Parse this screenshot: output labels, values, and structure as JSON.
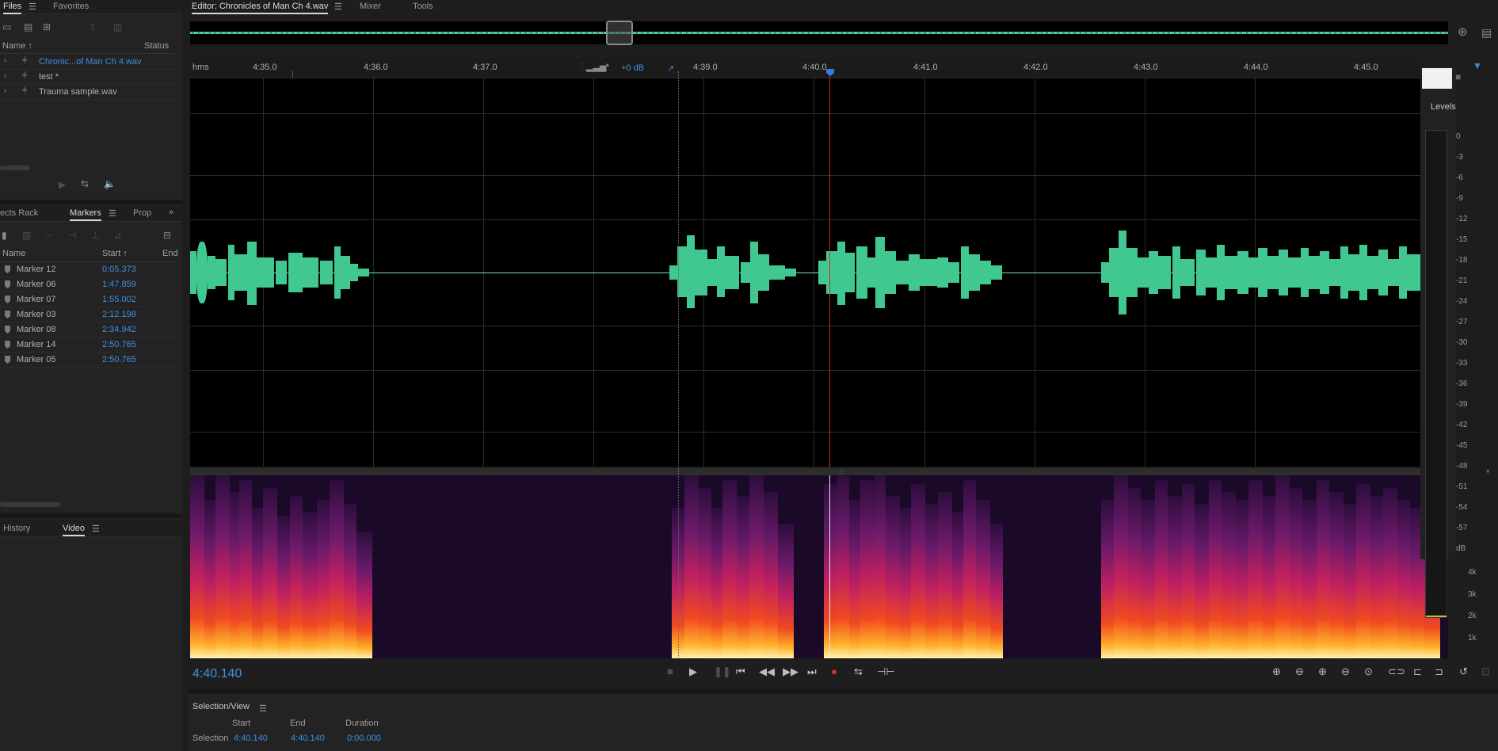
{
  "files_panel": {
    "tabs": [
      "Files",
      "Favorites"
    ],
    "col_name": "Name ↑",
    "col_status": "Status",
    "files": [
      {
        "name": "Chronic...of Man Ch 4.wav",
        "selected": true
      },
      {
        "name": "test *",
        "selected": false
      },
      {
        "name": "Trauma sample.wav",
        "selected": false
      }
    ]
  },
  "markers_panel": {
    "tabs": [
      "ects Rack",
      "Markers",
      "Prop"
    ],
    "col_name": "Name",
    "col_start": "Start ↑",
    "col_end": "End",
    "markers": [
      {
        "name": "Marker 12",
        "start": "0:05.373"
      },
      {
        "name": "Marker 06",
        "start": "1:47.859"
      },
      {
        "name": "Marker 07",
        "start": "1:55.002"
      },
      {
        "name": "Marker 03",
        "start": "2:12.198"
      },
      {
        "name": "Marker 08",
        "start": "2:34.942"
      },
      {
        "name": "Marker 14",
        "start": "2:50.765"
      },
      {
        "name": "Marker 05",
        "start": "2:50.765"
      }
    ]
  },
  "bottom_left_panel": {
    "tabs": [
      "History",
      "Video"
    ]
  },
  "editor": {
    "tab_editor": "Editor: Chronicles of Man Ch 4.wav",
    "tab_mixer": "Mixer",
    "tab_tools": "Tools",
    "gain": "+0 dB",
    "ruler_unit": "hms",
    "ruler_ticks": [
      "4:35.0",
      "4:36.0",
      "4:37.0",
      "4:39.0",
      "4:40.0",
      "4:41.0",
      "4:42.0",
      "4:43.0",
      "4:44.0",
      "4:45.0"
    ],
    "current_time": "4:40.140",
    "spec_labels": [
      "4k",
      "3k",
      "2k",
      "1k"
    ]
  },
  "levels": {
    "title": "Levels",
    "db_scale": [
      "0",
      "-3",
      "-6",
      "-9",
      "-12",
      "-15",
      "-18",
      "-21",
      "-24",
      "-27",
      "-30",
      "-33",
      "-36",
      "-39",
      "-42",
      "-45",
      "-48",
      "-51",
      "-54",
      "-57",
      "dB"
    ]
  },
  "selection_view": {
    "title": "Selection/View",
    "col_start": "Start",
    "col_end": "End",
    "col_duration": "Duration",
    "row_label": "Selection",
    "start": "4:40.140",
    "end": "4:40.140",
    "duration": "0:00.000"
  },
  "colors": {
    "waveform": "#41c891",
    "accent": "#3f8fe0",
    "playhead": "#c0302a",
    "record": "#e0302a"
  }
}
